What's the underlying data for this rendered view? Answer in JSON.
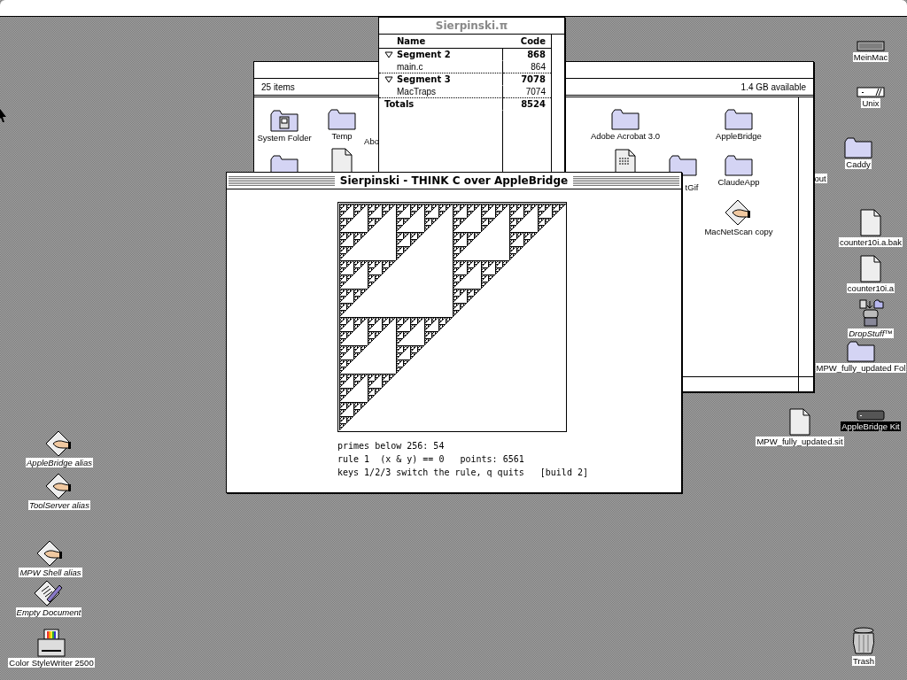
{
  "desktop_icons": [
    {
      "label": "MeinMac",
      "kind": "drive",
      "alias": false,
      "selected": false
    },
    {
      "label": "Unix",
      "kind": "cartridge",
      "alias": false,
      "selected": false
    },
    {
      "label": "Caddy",
      "kind": "folder",
      "alias": false,
      "selected": false
    },
    {
      "label": "counter10i.a.bak",
      "kind": "document",
      "alias": false,
      "selected": false
    },
    {
      "label": "counter10i.a",
      "kind": "document",
      "alias": false,
      "selected": false
    },
    {
      "label": "DropStuff™",
      "kind": "installer",
      "alias": true,
      "selected": false
    },
    {
      "label": "MPW_fully_updated Fol",
      "kind": "folder",
      "alias": false,
      "selected": false
    },
    {
      "label": "MPW_fully_updated.sit",
      "kind": "document",
      "alias": false,
      "selected": false
    },
    {
      "label": "AppleBridge Kit",
      "kind": "drive-dark",
      "alias": false,
      "selected": true
    },
    {
      "label": "out",
      "kind": "covered",
      "alias": false,
      "selected": false
    },
    {
      "label": "Trash",
      "kind": "trash",
      "alias": false,
      "selected": false
    },
    {
      "label": "AppleBridge alias",
      "kind": "alias-app",
      "alias": true,
      "selected": false
    },
    {
      "label": "ToolServer alias",
      "kind": "alias-app",
      "alias": true,
      "selected": false
    },
    {
      "label": "MPW Shell alias",
      "kind": "alias-app",
      "alias": true,
      "selected": false
    },
    {
      "label": "Empty Document",
      "kind": "stationery",
      "alias": true,
      "selected": false
    },
    {
      "label": "Color StyleWriter 2500",
      "kind": "printer",
      "alias": false,
      "selected": false
    }
  ],
  "finder_window": {
    "active": false,
    "item_count": "25 items",
    "available": "1.4 GB available",
    "icons": [
      {
        "label": "System Folder",
        "kind": "system-folder"
      },
      {
        "label": "Temp",
        "kind": "folder"
      },
      {
        "label": "Abo",
        "kind": "covered"
      },
      {
        "kind": "folder"
      },
      {
        "kind": "document"
      },
      {
        "label": "Adobe Acrobat 3.0",
        "kind": "folder"
      },
      {
        "label": "AppleBridge",
        "kind": "folder"
      },
      {
        "kind": "text-document"
      },
      {
        "kind": "folder"
      },
      {
        "label": "tGif",
        "kind": "covered"
      },
      {
        "label": "ClaudeApp",
        "kind": "folder"
      },
      {
        "label": "MacNetScan copy",
        "kind": "alias-app"
      }
    ]
  },
  "project_window": {
    "title": "Sierpinski.π",
    "active": false,
    "columns": [
      "Name",
      "Code"
    ],
    "rows": [
      {
        "kind": "segment",
        "name": "Segment 2",
        "code": "868",
        "expanded": true
      },
      {
        "kind": "file",
        "name": "main.c",
        "code": "864"
      },
      {
        "kind": "segment",
        "name": "Segment 3",
        "code": "7078",
        "expanded": true
      },
      {
        "kind": "file",
        "name": "MacTraps",
        "code": "7074"
      },
      {
        "kind": "total",
        "name": "Totals",
        "code": "8524"
      }
    ]
  },
  "app_window": {
    "title": "Sierpinski - THINK C over AppleBridge",
    "active": true,
    "lines": [
      "primes below 256: 54",
      "rule 1  (x & y) == 0   points: 6561",
      "keys 1/2/3 switch the rule, q quits   [build 2]"
    ]
  }
}
